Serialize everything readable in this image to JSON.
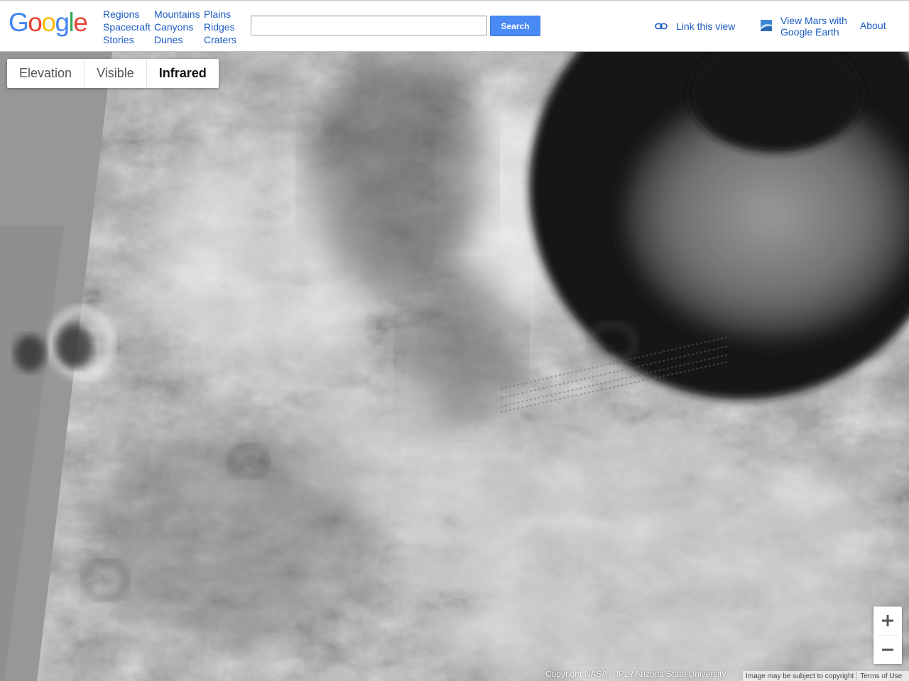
{
  "header": {
    "logo_text": "Google",
    "logo_letters": [
      {
        "ch": "G",
        "color": "#4285f4"
      },
      {
        "ch": "o",
        "color": "#ea4335"
      },
      {
        "ch": "o",
        "color": "#fbbc05"
      },
      {
        "ch": "g",
        "color": "#4285f4"
      },
      {
        "ch": "l",
        "color": "#34a853"
      },
      {
        "ch": "e",
        "color": "#ea4335"
      }
    ],
    "nav_columns": [
      [
        "Regions",
        "Spacecraft",
        "Stories"
      ],
      [
        "Mountains",
        "Canyons",
        "Dunes"
      ],
      [
        "Plains",
        "Ridges",
        "Craters"
      ]
    ],
    "search": {
      "value": "",
      "placeholder": "",
      "button_label": "Search"
    },
    "link_view": {
      "label": "Link this view",
      "icon": "link-icon"
    },
    "earth": {
      "line1": "View Mars with",
      "line2": "Google Earth",
      "icon": "google-earth-icon"
    },
    "about_label": "About"
  },
  "layers": {
    "tabs": [
      "Elevation",
      "Visible",
      "Infrared"
    ],
    "active": "Infrared"
  },
  "zoom": {
    "in_label": "+",
    "out_label": "−",
    "in_icon": "plus-icon",
    "out_icon": "minus-icon"
  },
  "footer": {
    "copyright": "Copyright NASA / JPL / Arizona State University",
    "notice": "Image may be subject to copyright",
    "terms": "Terms of Use"
  },
  "colors": {
    "link": "#1a5bc4",
    "search_button": "#4a8af4",
    "map_base": "#8a8a8a"
  }
}
